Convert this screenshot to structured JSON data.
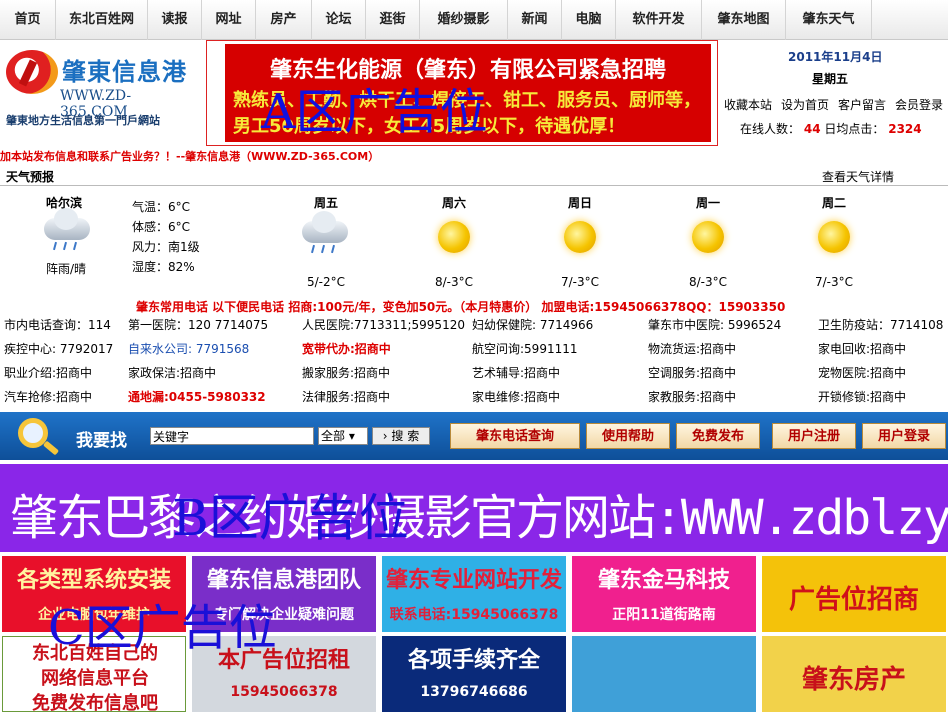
{
  "nav": [
    "首页",
    "东北百姓网",
    "读报",
    "网址",
    "房产",
    "论坛",
    "逛街",
    "婚纱摄影",
    "新闻",
    "电脑",
    "软件开发",
    "肇东地图",
    "肇东天气"
  ],
  "logo": {
    "name": "肇東信息港",
    "url": "WWW.ZD-365.COM",
    "slogan": "肇東地方生活信息第一門戶網站"
  },
  "ad_a": {
    "title": "肇东生化能源（肇东）有限公司紧急招聘",
    "body": "熟练员、工勤、烘干工、焊接工、钳工、服务员、厨师等，男工50周岁以下，女工45周岁以下，待遇优厚！",
    "overlay": "A区广告位"
  },
  "header_right": {
    "date": "2011年11月4日",
    "weekday": "星期五",
    "links": [
      "收藏本站",
      "设为首页",
      "客户留言",
      "会员登录"
    ],
    "online_label": "在线人数：",
    "online_count": "44",
    "avg_label": "日均点击：",
    "avg_count": "2324"
  },
  "notice": "加本站发布信息和联系广告业务？！--肇东信息港（WWW.ZD-365.COM）",
  "weather": {
    "section_title": "天气预报",
    "details_link": "查看天气详情",
    "city": "哈尔滨",
    "city_condition": "阵雨/晴",
    "details": [
      "气温：6°C",
      "体感：6°C",
      "风力：南1级",
      "湿度：82%"
    ],
    "days": [
      {
        "name": "周五",
        "temp": "5/-2°C",
        "icon": "rain-cloud-icon"
      },
      {
        "name": "周六",
        "temp": "8/-3°C",
        "icon": "sun-icon"
      },
      {
        "name": "周日",
        "temp": "7/-3°C",
        "icon": "sun-icon"
      },
      {
        "name": "周一",
        "temp": "8/-3°C",
        "icon": "sun-icon"
      },
      {
        "name": "周二",
        "temp": "7/-3°C",
        "icon": "sun-icon"
      }
    ]
  },
  "phones": {
    "title": "肇东常用电话 以下便民电话 招商:100元/年，变色加50元。（本月特惠价） 加盟电话:15945066378QQ：15903350",
    "rows": [
      [
        "市内电话查询：114",
        "第一医院：120 7714075",
        "人民医院:7713311;5995120",
        "妇幼保健院: 7714966",
        "肇东市中医院: 5996524",
        "卫生防疫站：7714108"
      ],
      [
        "疾控中心: 7792017",
        "自来水公司: 7791568",
        "宽带代办:招商中",
        "航空问询:5991111",
        "物流货运:招商中",
        "家电回收:招商中"
      ],
      [
        "职业介绍:招商中",
        "家政保洁:招商中",
        "搬家服务:招商中",
        "艺术辅导:招商中",
        "空调服务:招商中",
        "宠物医院:招商中"
      ],
      [
        "汽车抢修:招商中",
        "通地漏:0455-5980332",
        "法律服务:招商中",
        "家电维修:招商中",
        "家教服务:招商中",
        "开锁修锁:招商中"
      ]
    ]
  },
  "search": {
    "label": "我要找",
    "placeholder": "关键字",
    "scope": "全部",
    "submit": "搜 索",
    "buttons": [
      "肇东电话查询",
      "使用帮助",
      "免费发布",
      "用户注册",
      "用户登录"
    ]
  },
  "ad_b": {
    "text": "肇东巴黎之约婚纱摄影官方网站:WWW.zdblzy.COM",
    "overlay": "B区广告位"
  },
  "ad_c": {
    "overlay": "C区广告位",
    "tiles": [
      {
        "lines": [
          "各类型系统安装",
          "企业电脑包年维护"
        ],
        "bg": "#e8102a",
        "fg": "#fff4a0"
      },
      {
        "lines": [
          "肇东信息港团队",
          "专门解决企业疑难问题"
        ],
        "bg": "#7a2ec9",
        "fg": "#ffffff"
      },
      {
        "lines": [
          "肇东专业网站开发",
          "联系电话:15945066378"
        ],
        "bg": "#2fb0e6",
        "fg": "#e2203a"
      },
      {
        "lines": [
          "肇东金马科技",
          "正阳11道街路南"
        ],
        "bg": "#f0208e",
        "fg": "#ffffff"
      },
      {
        "lines": [
          "广告位招商"
        ],
        "bg": "#f4c20a",
        "fg": "#d0101a"
      },
      {
        "lines": [
          "东北百姓自己的",
          "网络信息平台",
          "免费发布信息吧"
        ],
        "bg": "#ffffff",
        "fg": "#c8101a"
      },
      {
        "lines": [
          "本广告位招租",
          "15945066378"
        ],
        "bg": "#d3d8de",
        "fg": "#c8101a"
      },
      {
        "lines": [
          "各项手续齐全",
          "13796746686"
        ],
        "bg": "#0a2a7a",
        "fg": "#ffffff"
      },
      {
        "lines": [
          ""
        ],
        "bg": "#3fa0d8",
        "fg": "#ffffff"
      },
      {
        "lines": [
          "肇东房产"
        ],
        "bg": "#f2d24a",
        "fg": "#c8101a"
      }
    ]
  },
  "colors": {
    "nav_bg": "#efefef",
    "accent_red": "#d60000",
    "search_blue": "#1a66b8",
    "ad_b_purple": "#8a26e8"
  }
}
